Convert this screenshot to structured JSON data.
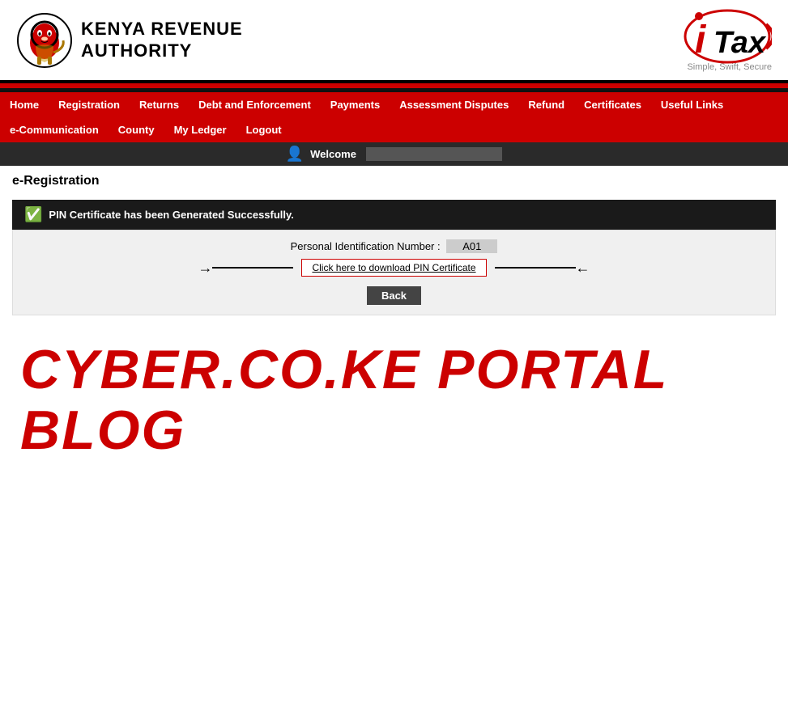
{
  "header": {
    "kra_name_line1": "Kenya Revenue",
    "kra_name_line2": "Authority",
    "itax_i": "i",
    "itax_tax": "Tax",
    "itax_tagline": "Simple, Swift, Secure"
  },
  "nav": {
    "row1": [
      {
        "label": "Home",
        "key": "home"
      },
      {
        "label": "Registration",
        "key": "registration"
      },
      {
        "label": "Returns",
        "key": "returns"
      },
      {
        "label": "Debt and Enforcement",
        "key": "debt"
      },
      {
        "label": "Payments",
        "key": "payments"
      },
      {
        "label": "Assessment Disputes",
        "key": "assessment"
      },
      {
        "label": "Refund",
        "key": "refund"
      },
      {
        "label": "Certificates",
        "key": "certificates"
      },
      {
        "label": "Useful Links",
        "key": "links"
      }
    ],
    "row2": [
      {
        "label": "e-Communication",
        "key": "ecommunication"
      },
      {
        "label": "County",
        "key": "county"
      },
      {
        "label": "My Ledger",
        "key": "ledger"
      },
      {
        "label": "Logout",
        "key": "logout"
      }
    ]
  },
  "welcome_bar": {
    "welcome_label": "Welcome",
    "user_name": ""
  },
  "page": {
    "title_bold": "e-Registration",
    "title_normal": "",
    "success_message": "PIN Certificate has been Generated Successfully.",
    "pin_label": "Personal Identification Number :",
    "pin_value": "A01",
    "download_link_text": "Click here to download PIN Certificate",
    "back_button": "Back"
  },
  "watermark": {
    "text": "CYBER.CO.KE PORTAL BLOG"
  }
}
